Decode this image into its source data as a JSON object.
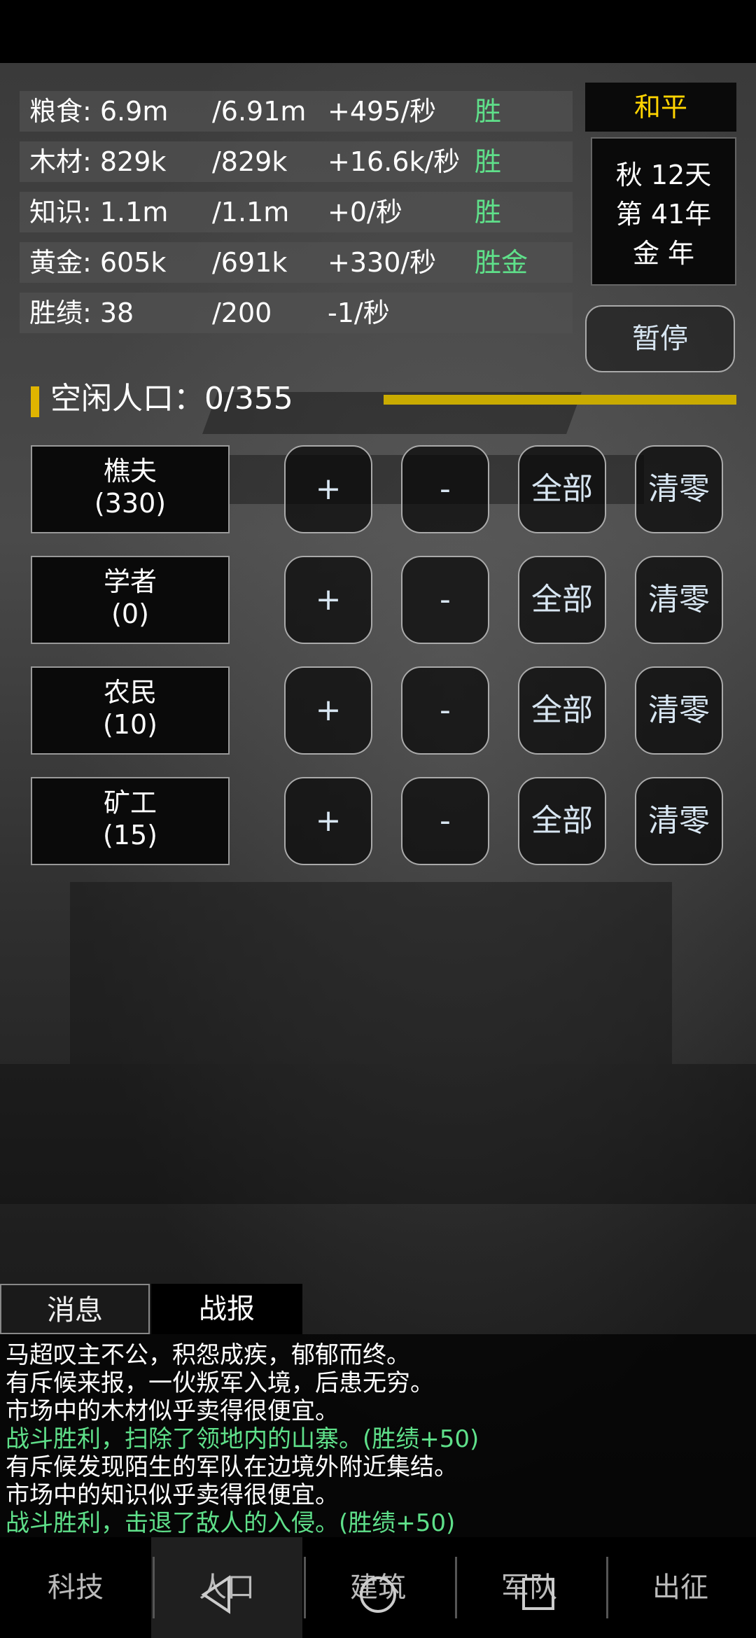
{
  "resources": [
    {
      "label": "粮食: 6.9m",
      "max": "/6.91m",
      "rate": "+495/秒",
      "mark": "胜"
    },
    {
      "label": "木材: 829k",
      "max": "/829k",
      "rate": "+16.6k/秒",
      "mark": "胜"
    },
    {
      "label": "知识: 1.1m",
      "max": "/1.1m",
      "rate": "+0/秒",
      "mark": "胜"
    },
    {
      "label": "黄金: 605k",
      "max": "/691k",
      "rate": "+330/秒",
      "mark": "胜金"
    },
    {
      "label": "胜绩: 38",
      "max": "/200",
      "rate": "-1/秒",
      "mark": ""
    }
  ],
  "status": {
    "peace": "和平",
    "season_day": "秋 12天",
    "year": "第 41年",
    "element_year": "金 年",
    "pause": "暂停"
  },
  "idle": {
    "label": "空闲人口：0/355"
  },
  "jobs": [
    {
      "name": "樵夫",
      "count": "(330)"
    },
    {
      "name": "学者",
      "count": "(0)"
    },
    {
      "name": "农民",
      "count": "(10)"
    },
    {
      "name": "矿工",
      "count": "(15)"
    }
  ],
  "controls": {
    "plus": "+",
    "minus": "-",
    "all": "全部",
    "clear": "清零"
  },
  "tabs": {
    "messages": "消息",
    "battle": "战报"
  },
  "log": [
    {
      "text": "马超叹主不公，积怨成疾，郁郁而终。",
      "color": "white"
    },
    {
      "text": "有斥候来报，一伙叛军入境，后患无穷。",
      "color": "white"
    },
    {
      "text": "市场中的木材似乎卖得很便宜。",
      "color": "white"
    },
    {
      "text": "战斗胜利，扫除了领地内的山寨。(胜绩+50)",
      "color": "green"
    },
    {
      "text": "有斥候发现陌生的军队在边境外附近集结。",
      "color": "white"
    },
    {
      "text": "市场中的知识似乎卖得很便宜。",
      "color": "white"
    },
    {
      "text": "战斗胜利，击退了敌人的入侵。(胜绩+50)",
      "color": "green"
    }
  ],
  "nav": [
    "科技",
    "人口",
    "建筑",
    "军队",
    "出征"
  ],
  "colors": {
    "accent_yellow": "#ffd400",
    "success_green": "#5fe08a",
    "button_text": "#d8e6f2"
  }
}
